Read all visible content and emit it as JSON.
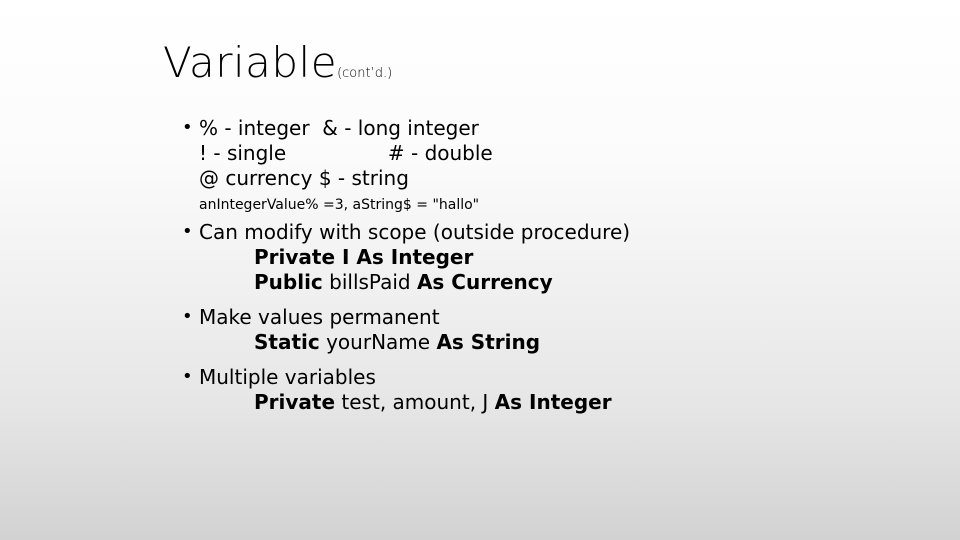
{
  "slide": {
    "title": "Variable",
    "title_suffix": "(cont’d.)",
    "bullets": [
      {
        "lines": [
          "% - integer  & - long integer",
          "! - single                # - double",
          "@ currency $ - string"
        ],
        "example": "anIntegerValue% =3, aString$ = \"hallo\""
      },
      {
        "text": "Can modify with scope (outside procedure)",
        "code": [
          {
            "kw1": "Private",
            "mid": " I ",
            "kw2": "As Integer"
          },
          {
            "kw1": "Public",
            "mid": " billsPaid ",
            "kw2": "As Currency"
          }
        ]
      },
      {
        "text": "Make values permanent",
        "code": [
          {
            "kw1": "Static",
            "mid": " yourName ",
            "kw2": "As String"
          }
        ]
      },
      {
        "text": "Multiple variables",
        "code": [
          {
            "kw1": "Private",
            "mid": " test, amount, J ",
            "kw2": "As Integer"
          }
        ]
      }
    ]
  }
}
